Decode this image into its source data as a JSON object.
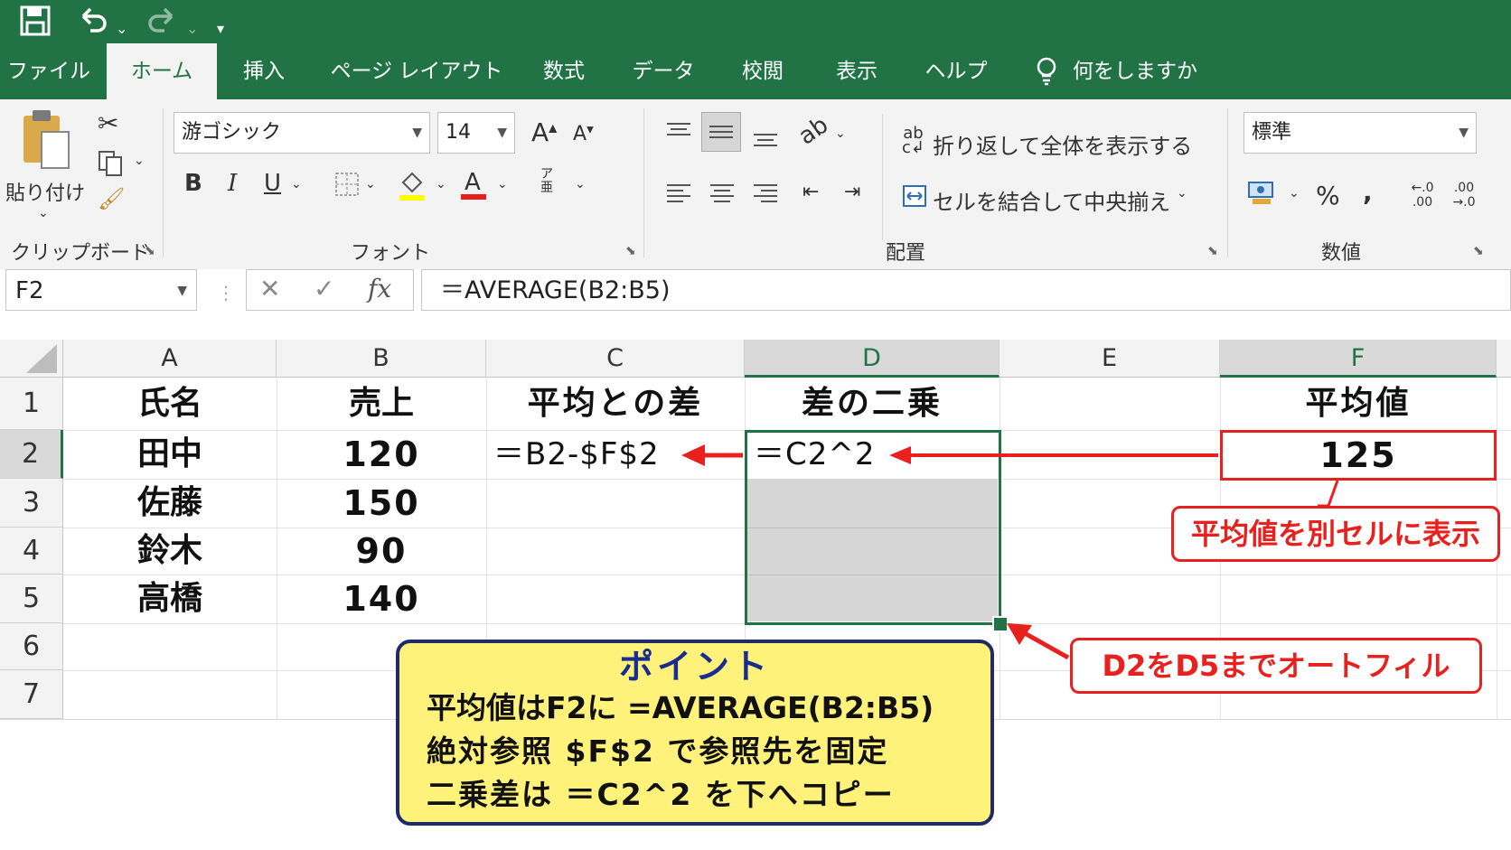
{
  "quick_access": {
    "save_icon": "save-icon",
    "undo_icon": "undo-icon",
    "redo_icon": "redo-icon",
    "customize_icon": "customize-icon"
  },
  "tabs": [
    {
      "label": "ファイル"
    },
    {
      "label": "ホーム",
      "active": true
    },
    {
      "label": "挿入"
    },
    {
      "label": "ページ レイアウト"
    },
    {
      "label": "数式"
    },
    {
      "label": "データ"
    },
    {
      "label": "校閲"
    },
    {
      "label": "表示"
    },
    {
      "label": "ヘルプ"
    }
  ],
  "tell_me": {
    "placeholder": "何をしますか"
  },
  "ribbon": {
    "clipboard": {
      "paste_label": "貼り付け",
      "group_label": "クリップボード"
    },
    "font": {
      "font_name": "游ゴシック",
      "font_size": "14",
      "bold": "B",
      "italic": "I",
      "underline": "U",
      "group_label": "フォント",
      "grow_font": "A",
      "shrink_font": "A"
    },
    "alignment": {
      "wrap_text": "折り返して全体を表示する",
      "merge_center": "セルを結合して中央揃え",
      "group_label": "配置"
    },
    "number": {
      "format": "標準",
      "percent": "%",
      "comma": ",",
      "group_label": "数値",
      "inc_decimal": "←.0 .00",
      "dec_decimal": ".00 →.0"
    }
  },
  "formula_bar": {
    "name_box": "F2",
    "formula": "＝AVERAGE(B2:B5)",
    "fx_label": "fx"
  },
  "columns": [
    "A",
    "B",
    "C",
    "D",
    "E",
    "F"
  ],
  "rows": [
    "1",
    "2",
    "3",
    "4",
    "5",
    "6",
    "7"
  ],
  "cells": {
    "A1": "氏名",
    "B1": "売上",
    "C1": "平均との差",
    "D1": "差の二乗",
    "F1": "平均値",
    "A2": "田中",
    "B2": "120",
    "C2": "＝B2-$F$2",
    "D2": "＝C2^2",
    "F2": "125",
    "A3": "佐藤",
    "B3": "150",
    "A4": "鈴木",
    "B4": "90",
    "A5": "高橋",
    "B5": "140"
  },
  "annotations": {
    "avg_note": "平均値を別セルに表示",
    "autofill_note": "D2をD5までオートフィル",
    "point_title": "ポイント",
    "point_lines": [
      "平均値はF2に =AVERAGE(B2:B5)",
      "絶対参照 $F$2 で参照先を固定",
      "二乗差は ＝C2^2 を下へコピー"
    ]
  },
  "colors": {
    "excel_green": "#217346",
    "highlight_red": "#e8201e",
    "note_yellow": "#fff27a",
    "note_border": "#1f2a6b",
    "note_title": "#1a2c8f"
  }
}
